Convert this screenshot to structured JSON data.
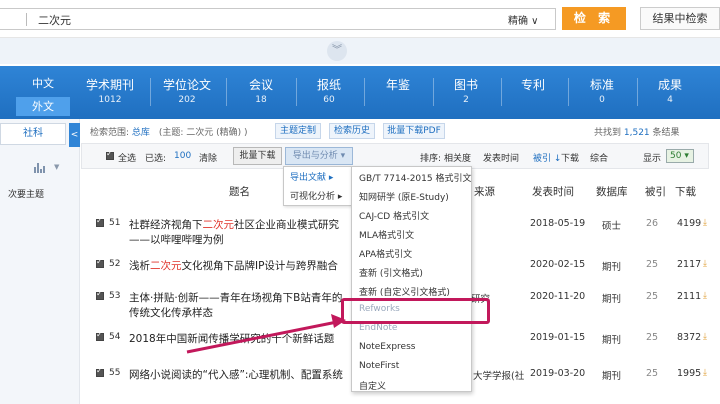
{
  "search": {
    "query": "二次元",
    "match_mode": "精确 ∨",
    "search_button": "检 索",
    "result_search_button": "结果中检索"
  },
  "collapse_icon": "double-chevron-down-icon",
  "lang": {
    "zh": "中文",
    "wai": "外文"
  },
  "db_tabs": [
    {
      "label": "学术期刊",
      "count": "1012"
    },
    {
      "label": "学位论文",
      "count": "202"
    },
    {
      "label": "会议",
      "count": "18"
    },
    {
      "label": "报纸",
      "count": "60"
    },
    {
      "label": "年鉴",
      "count": ""
    },
    {
      "label": "图书",
      "count": "2"
    },
    {
      "label": "专利",
      "count": ""
    },
    {
      "label": "标准",
      "count": "0"
    },
    {
      "label": "成果",
      "count": "4"
    }
  ],
  "side": {
    "subject_tab": "社科",
    "collapse_label": "<",
    "sub_topic_label": "次要主题"
  },
  "scope": {
    "prefix": "检索范围:",
    "db": "总库",
    "topic": "(主题: 二次元 (精确) )",
    "buttons": [
      "主题定制",
      "检索历史",
      "批量下载PDF"
    ]
  },
  "total": {
    "prefix": "共找到",
    "count": "1,521",
    "suffix": "条结果"
  },
  "toolbar": {
    "select_all": "全选",
    "selected_label": "已选:",
    "selected_count": "100",
    "clear": "清除",
    "batch_download": "批量下载",
    "export_analyze": "导出与分析 ▾",
    "sort_label": "排序:",
    "sort_relevance": "相关度",
    "sort_date": "发表时间",
    "sort_cite": "被引 ↓",
    "sort_download": "下载",
    "sort_overall": "综合",
    "show_label": "显示",
    "show_value": "50 ▾"
  },
  "headers": {
    "title": "题名",
    "source": "来源",
    "date": "发表时间",
    "db": "数据库",
    "cite": "被引",
    "download": "下载"
  },
  "rows": [
    {
      "num": "51",
      "title_a": "社群经济视角下",
      "title_hl": "二次元",
      "title_b": "社区企业商业模式研究",
      "title_line2": "——以哔哩哔哩为例",
      "source": "",
      "date": "2018-05-19",
      "db": "硕士",
      "cite": "26",
      "download": "4199"
    },
    {
      "num": "52",
      "title_a": "浅析",
      "title_hl": "二次元",
      "title_b": "文化视角下品牌IP设计与跨界融合",
      "title_line2": "",
      "source": "",
      "date": "2020-02-15",
      "db": "期刊",
      "cite": "25",
      "download": "2117"
    },
    {
      "num": "53",
      "title_a": "主体·拼贴·创新——青年在场视角下B站青年的",
      "title_hl": "",
      "title_b": "",
      "title_line2": "传统文化传承样态",
      "source": "研究",
      "date": "2020-11-20",
      "db": "期刊",
      "cite": "25",
      "download": "2111"
    },
    {
      "num": "54",
      "title_a": "2018年中国新闻传播学研究的十个新鲜话题",
      "title_hl": "",
      "title_b": "",
      "title_line2": "",
      "source": "",
      "date": "2019-01-15",
      "db": "期刊",
      "cite": "25",
      "download": "8372"
    },
    {
      "num": "55",
      "title_a": "网络小说阅读的“代入感”:心理机制、配置系统",
      "title_hl": "",
      "title_b": "",
      "title_line2": "",
      "source": "大学学报(社",
      "date": "2019-03-20",
      "db": "期刊",
      "cite": "25",
      "download": "1995"
    }
  ],
  "sub_menu": [
    "导出文献 ▸",
    "可视化分析 ▸"
  ],
  "format_menu": [
    "GB/T 7714-2015 格式引文",
    "知网研学 (原E-Study)",
    "CAJ-CD 格式引文",
    "MLA格式引文",
    "APA格式引文",
    "查新 (引文格式)",
    "查新 (自定义引文格式)",
    "Refworks",
    "EndNote",
    "NoteExpress",
    "NoteFirst",
    "自定义"
  ],
  "colors": {
    "accent": "#1f6fc0",
    "search_btn": "#f59a23",
    "highlight": "#e0362c",
    "annotation": "#c2185b"
  }
}
